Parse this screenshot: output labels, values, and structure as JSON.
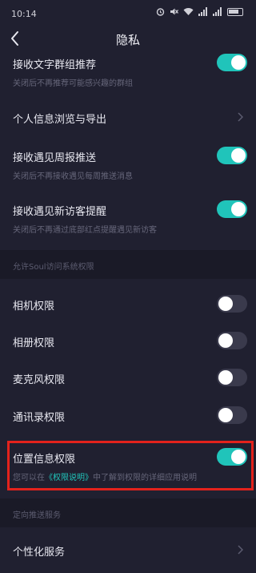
{
  "status_bar": {
    "time": "10:14"
  },
  "nav": {
    "title": "隐私"
  },
  "rows": {
    "group_recommend": {
      "title": "接收文字群组推荐",
      "subtitle": "关闭后不再推荐可能感兴趣的群组",
      "toggle_on": true
    },
    "personal_info": {
      "title": "个人信息浏览与导出"
    },
    "weekly_report": {
      "title": "接收遇见周报推送",
      "subtitle": "关闭后不再接收遇见每周推送消息",
      "toggle_on": true
    },
    "new_visitor": {
      "title": "接收遇见新访客提醒",
      "subtitle": "关闭后不再通过底部红点提醒遇见新访客",
      "toggle_on": true
    },
    "camera": {
      "title": "相机权限",
      "toggle_on": false
    },
    "album": {
      "title": "相册权限",
      "toggle_on": false
    },
    "microphone": {
      "title": "麦克风权限",
      "toggle_on": false
    },
    "contacts": {
      "title": "通讯录权限",
      "toggle_on": false
    },
    "location": {
      "title": "位置信息权限",
      "subtitle_pre": "您可以在",
      "subtitle_link": "《权限说明》",
      "subtitle_post": "中了解到权限的详细应用说明",
      "toggle_on": true
    },
    "personalized": {
      "title": "个性化服务"
    }
  },
  "sections": {
    "system_permissions": "允许Soul访问系统权限",
    "targeted_push": "定向推送服务"
  },
  "colors": {
    "accent": "#20c4ba",
    "background": "#202030",
    "highlight": "#e3221c"
  }
}
